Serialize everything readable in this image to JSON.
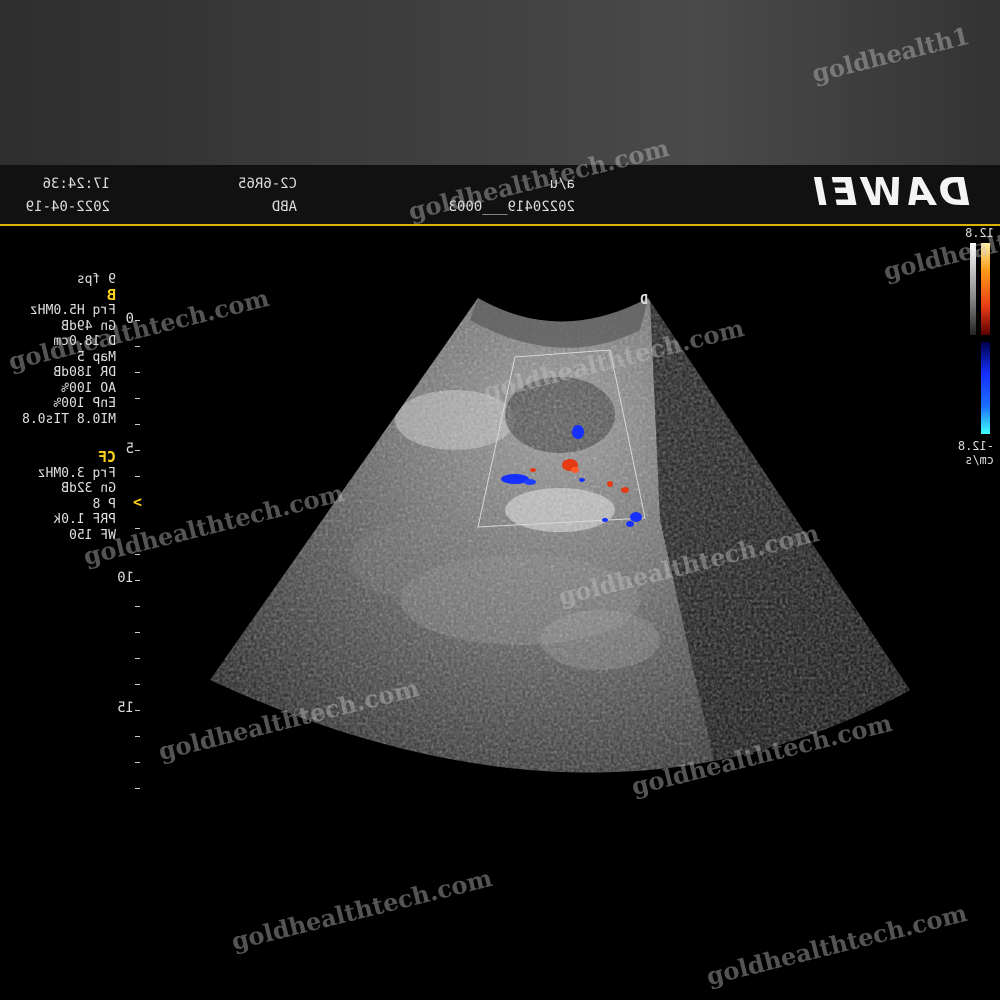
{
  "header": {
    "brand": "DAWEI",
    "probe": "C2-6R65",
    "preset": "ABD",
    "time": "17:24:36",
    "date": "2022-04-19",
    "patient_id": "a/u",
    "exam_id": "20220419___0003"
  },
  "b_mode": {
    "fps": "9 fps",
    "mode_label": "B",
    "params": [
      "Frq  H5.0MHz",
      "Gn  49dB",
      "D  18.0cm",
      "Map 5",
      "DR  180dB",
      "AO  100%",
      "EnP 100%",
      "MI0.8 TIs0.8"
    ]
  },
  "color_flow": {
    "mode_label": "CF",
    "params": [
      "Frq 3.0MHz",
      "Gn 32dB",
      "P  8",
      "PRF 1.0k",
      "WF 150"
    ]
  },
  "depth_scale": {
    "labels": [
      "0",
      "5",
      "10",
      "15"
    ],
    "focus_marker": ">"
  },
  "velocity_scale": {
    "max": "12.8",
    "min": "-12.8",
    "unit": "cm/s",
    "positive_color": "#e53a14",
    "negative_color": "#1530ff"
  },
  "probe_orientation_marker": "D",
  "watermarks": [
    "goldhealth1",
    "goldhealthtech.com",
    "goldhealthtech.com",
    "goldhealthtech.com",
    "goldhealthtech.com",
    "goldhealthtech.com",
    "goldhealthtech.com",
    "goldhealthtech.com",
    "goldhealthtech.com",
    "goldhealthtech.com",
    "goldhealthtech.com",
    "goldhealthtech.com",
    "goldhealthtech.com"
  ],
  "colors": {
    "accent_line": "#d9b400",
    "mode_label": "#ffd21a"
  }
}
